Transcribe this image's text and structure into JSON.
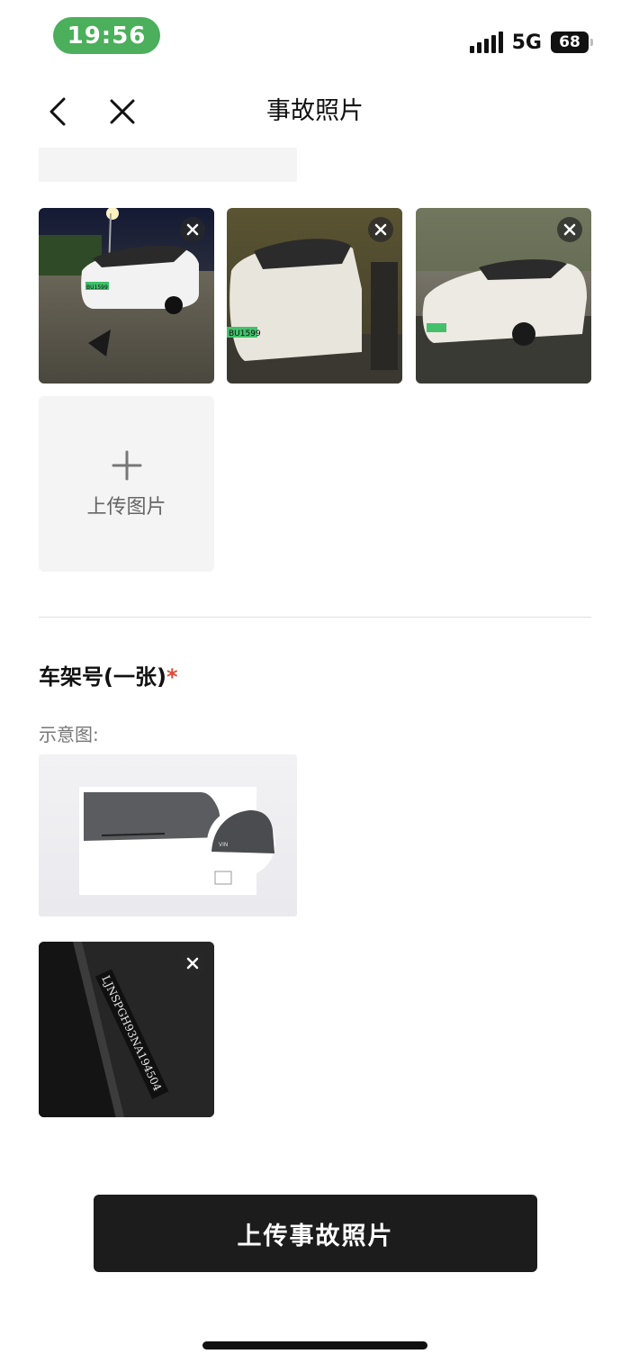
{
  "status_bar": {
    "time": "19:56",
    "network": "5G",
    "battery": "68"
  },
  "nav": {
    "title": "事故照片"
  },
  "photos": [
    {
      "plate_text": "BU1599",
      "alt": "accident-photo-1"
    },
    {
      "plate_text": "BU1599",
      "alt": "accident-photo-2"
    },
    {
      "plate_text": "BU1599",
      "alt": "accident-photo-3"
    }
  ],
  "upload": {
    "label": "上传图片"
  },
  "vin_section": {
    "title": "车架号(一张)",
    "required_mark": "*",
    "example_label": "示意图:",
    "vin_text": "LJNSPGH93NA194504"
  },
  "submit": {
    "label": "上传事故照片"
  },
  "colors": {
    "time_pill": "#4caf5b",
    "button": "#1c1c1c",
    "required": "#e04a3a"
  }
}
